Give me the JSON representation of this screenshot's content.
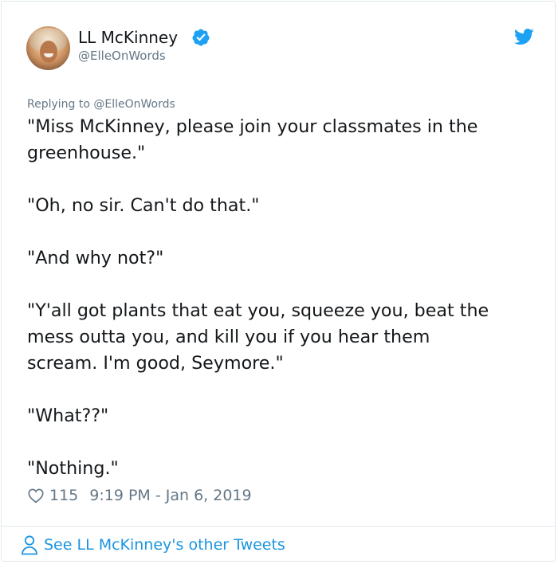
{
  "author": {
    "name": "LL McKinney",
    "handle": "@ElleOnWords",
    "verified": true
  },
  "reply_to": "Replying to @ElleOnWords",
  "tweet_lines": [
    "\"Miss McKinney, please join your classmates in the",
    "greenhouse.\"",
    "",
    "\"Oh, no sir. Can't do that.\"",
    "",
    "\"And why not?\"",
    "",
    "\"Y'all got plants that eat you, squeeze you, beat the",
    "mess outta you, and kill you if you hear them",
    "scream. I'm good, Seymore.\"",
    "",
    "\"What??\"",
    "",
    "\"Nothing.\""
  ],
  "stats": {
    "likes": "115",
    "timestamp": "9:19 PM - Jan 6, 2019"
  },
  "footer": {
    "label": "See LL McKinney's other Tweets"
  },
  "icons": {
    "verified": "verified-badge-icon",
    "bird": "twitter-bird-icon",
    "heart": "heart-icon",
    "person": "person-icon"
  },
  "colors": {
    "twitter_blue": "#1da1f2",
    "link_blue": "#1b95e0",
    "text": "#14171a",
    "muted": "#657786",
    "border": "#e1e8ed"
  }
}
